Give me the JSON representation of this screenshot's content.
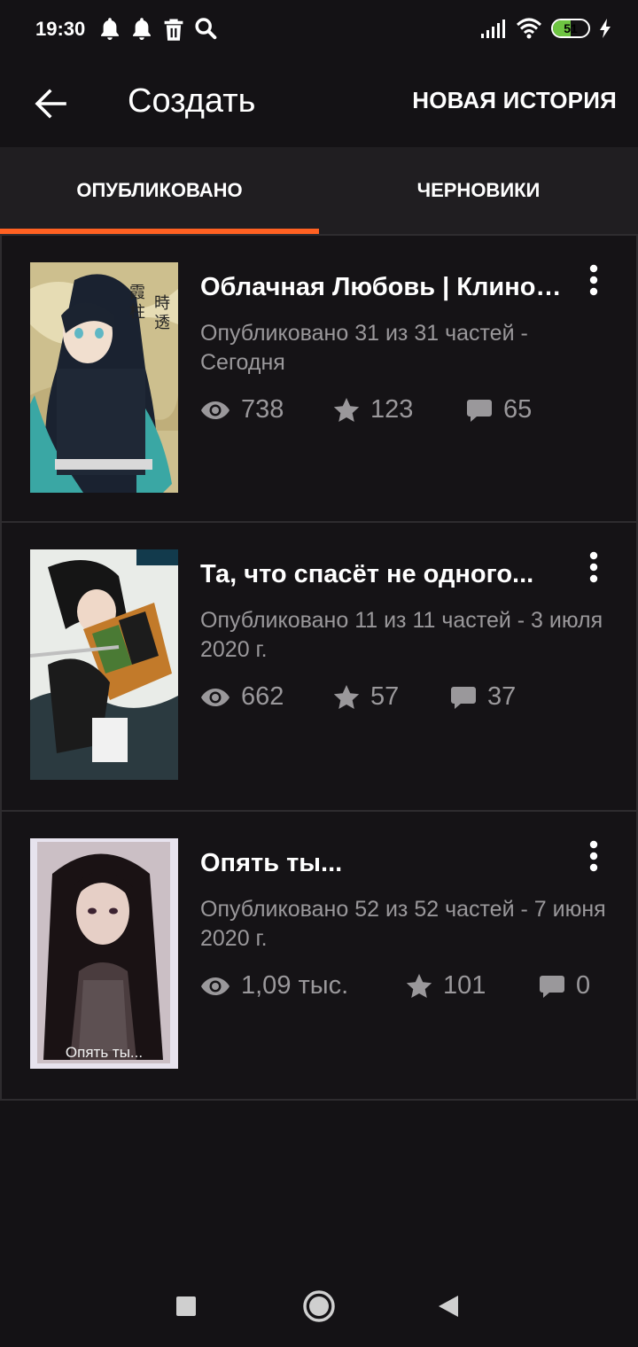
{
  "status_bar": {
    "time": "19:30",
    "battery_level": "51",
    "battery_fraction": 0.51,
    "notification_icons": [
      "bell-icon",
      "bell-icon",
      "trash-icon",
      "search-icon"
    ],
    "right_icons": [
      "signal-icon",
      "wifi-icon",
      "battery-icon",
      "charging-icon"
    ]
  },
  "app_bar": {
    "title": "Создать",
    "back_icon": "arrow-left-icon",
    "new_story_label": "НОВАЯ ИСТОРИЯ"
  },
  "tabs": [
    {
      "label": "ОПУБЛИКОВАНО",
      "active": true
    },
    {
      "label": "ЧЕРНОВИКИ",
      "active": false
    }
  ],
  "colors": {
    "accent": "#ff6122",
    "background": "#141215",
    "tabs_background": "#201e21",
    "secondary_text": "#9a989b"
  },
  "stories": [
    {
      "title": "Облачная Любовь | Клинок, рассекающий демонов",
      "meta": "Опубликовано 31 из 31 частей - Сегодня",
      "views": "738",
      "votes": "123",
      "comments": "65",
      "cover_text": ""
    },
    {
      "title": "Та, что спасёт не одного...",
      "meta": "Опубликовано 11 из 11 частей - 3 июля 2020 г.",
      "views": "662",
      "votes": "57",
      "comments": "37",
      "cover_text": ""
    },
    {
      "title": "Опять ты...",
      "meta": "Опубликовано 52 из 52 частей - 7 июня 2020 г.",
      "views": "1,09 тыс.",
      "votes": "101",
      "comments": "0",
      "cover_text": "Опять ты..."
    }
  ],
  "nav_bar": {
    "buttons": [
      "recents-square-icon",
      "home-circle-icon",
      "back-triangle-icon"
    ]
  }
}
